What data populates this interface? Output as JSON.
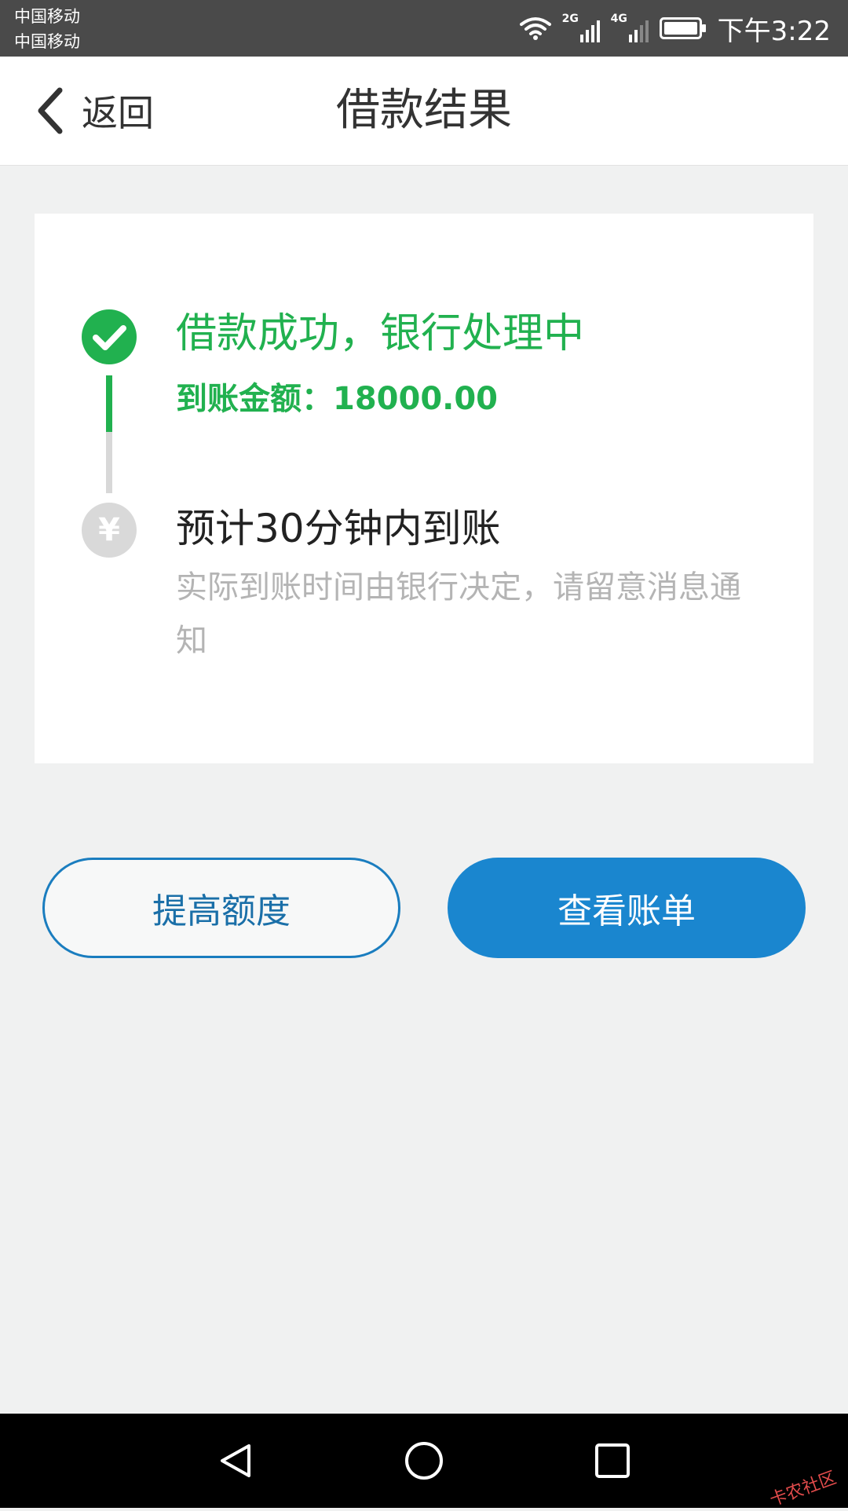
{
  "status_bar": {
    "carrier_1": "中国移动",
    "carrier_2": "中国移动",
    "signal_1_label": "2G",
    "signal_2_label": "4G",
    "time": "下午3:22"
  },
  "header": {
    "back_label": "返回",
    "title": "借款结果"
  },
  "steps": [
    {
      "icon": "check-icon",
      "title": "借款成功，银行处理中",
      "detail": "到账金额：18000.00",
      "color": "#21b14f"
    },
    {
      "icon": "yen-icon",
      "symbol": "¥",
      "title": "预计30分钟内到账",
      "detail": "实际到账时间由银行决定，请留意消息通知",
      "color": "#d9d9d9"
    }
  ],
  "buttons": {
    "raise_limit": "提高额度",
    "view_bill": "查看账单"
  },
  "watermark": "卡农社区",
  "colors": {
    "success": "#21b14f",
    "primary": "#1a86cf",
    "background": "#f0f1f1"
  }
}
